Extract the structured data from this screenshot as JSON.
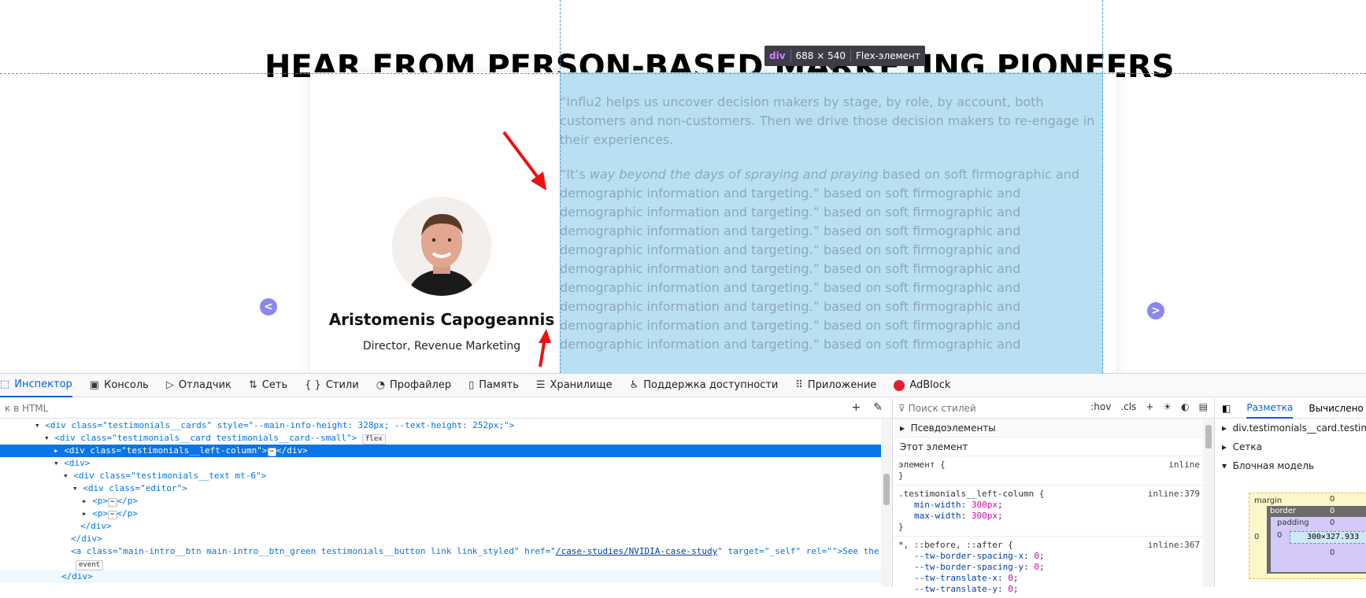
{
  "page": {
    "heading": "HEAR FROM PERSON-BASED MARKETING PIONEERS",
    "tooltip": {
      "tag": "div",
      "size": "688 × 540",
      "kind": "Flex-элемент"
    },
    "person": {
      "name": "Aristomenis Capogeannis",
      "role": "Director, Revenue Marketing"
    },
    "quote_1": "“Influ2 helps us uncover decision makers by stage, by role, by account, both customers and non-customers. Then we drive those decision makers to re-engage in their experiences.",
    "quote_2_start": "“It’s ",
    "quote_2_em": "way beyond the days of spraying and praying",
    "quote_2_rest": " based on soft firmographic and demographic information and targeting.” based on soft firmographic and demographic information and targeting.” based on soft firmographic and demographic information and targeting.” based on soft firmographic and demographic information and targeting.” based on soft firmographic and demographic information and targeting.” based on soft firmographic and demographic information and targeting.” based on soft firmographic and demographic information and targeting.” based on soft firmographic and demographic information and targeting.” based on soft firmographic and demographic information and targeting.” based on soft firmographic and"
  },
  "devtools": {
    "tabs": [
      {
        "label": "Инспектор",
        "icon": "inspector-icon"
      },
      {
        "label": "Консоль",
        "icon": "console-icon"
      },
      {
        "label": "Отладчик",
        "icon": "debugger-icon"
      },
      {
        "label": "Сеть",
        "icon": "network-icon"
      },
      {
        "label": "Стили",
        "icon": "style-editor-icon"
      },
      {
        "label": "Профайлер",
        "icon": "profiler-icon"
      },
      {
        "label": "Память",
        "icon": "memory-icon"
      },
      {
        "label": "Хранилище",
        "icon": "storage-icon"
      },
      {
        "label": "Поддержка доступности",
        "icon": "accessibility-icon"
      },
      {
        "label": "Приложение",
        "icon": "application-icon"
      },
      {
        "label": "AdBlock",
        "icon": "adblock-icon"
      }
    ],
    "html_search_placeholder": "к в HTML",
    "tree": {
      "r0": "<div class=\"testimonials__cards\" style=\"--main-info-height: 328px; --text-height: 252px;\">",
      "r1_open": "<div class=\"testimonials__card testimonials__card--small\">",
      "r1_badge": "flex",
      "r2": "<div class=\"testimonials__left-column\">",
      "r2_close": "</div>",
      "r3": "<div>",
      "r4": "<div class=\"testimonials__text mt-6\">",
      "r5": "<div class=\"editor\">",
      "r6": "<p>",
      "r6_close": "</p>",
      "r7": "<p>",
      "r7_close": "</p>",
      "r8": "</div>",
      "r9": "</div>",
      "r10_a": "<a class=\"main-intro__btn main-intro__btn_green testimonials__button link link_styled\" href=\"",
      "r10_href": "/case-studies/NVIDIA-case-study",
      "r10_b": "\" target=\"_self\" rel=\"\">See the case study</a>",
      "r11_badge": "event",
      "r12": "</div>",
      "ellipsis": "⋯"
    },
    "rules": {
      "search_placeholder": "Поиск стилей",
      "hov": ":hov",
      "cls": ".cls",
      "pseudo": "Псевдоэлементы",
      "this_element": "Этот элемент",
      "element_selector": "элемент {",
      "element_src": "inline",
      "close": "}",
      "rule1_selector": ".testimonials__left-column {",
      "rule1_src": "inline:379",
      "rule1_p1_name": "min-width",
      "rule1_p1_value": "300px",
      "rule1_p2_name": "max-width",
      "rule1_p2_value": "300px",
      "rule2_selector": "*, ::before, ::after {",
      "rule2_src": "inline:367",
      "rule2_props": [
        {
          "name": "--tw-border-spacing-x",
          "value": "0"
        },
        {
          "name": "--tw-border-spacing-y",
          "value": "0"
        },
        {
          "name": "--tw-translate-x",
          "value": "0"
        },
        {
          "name": "--tw-translate-y",
          "value": "0"
        }
      ]
    },
    "layout": {
      "tab_layout": "Разметка",
      "tab_computed": "Вычислено",
      "node": "div.testimonials__card.testimon",
      "grid": "Сетка",
      "box_model": "Блочная модель",
      "margin": "margin",
      "border": "border",
      "padding": "padding",
      "zero": "0",
      "content_size": "300×327.933"
    }
  }
}
